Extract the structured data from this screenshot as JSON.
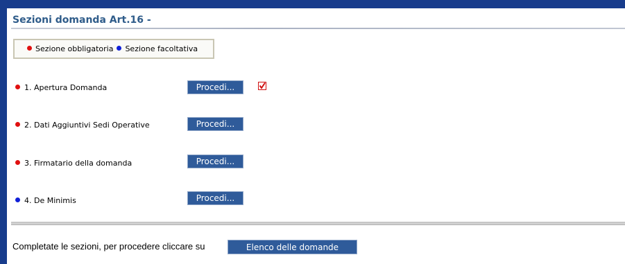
{
  "header": {
    "title": "Sezioni domanda Art.16 -"
  },
  "legend": {
    "mandatory_label": "Sezione obbligatoria",
    "optional_label": "Sezione facoltativa"
  },
  "sections": [
    {
      "label": "1. Apertura Domanda",
      "type": "obbligatoria",
      "button_label": "Procedi...",
      "completed": true
    },
    {
      "label": "2. Dati Aggiuntivi Sedi Operative",
      "type": "obbligatoria",
      "button_label": "Procedi...",
      "completed": false
    },
    {
      "label": "3. Firmatario della domanda",
      "type": "obbligatoria",
      "button_label": "Procedi...",
      "completed": false
    },
    {
      "label": "4. De Minimis",
      "type": "facoltativa",
      "button_label": "Procedi...",
      "completed": false
    }
  ],
  "footer": {
    "text": "Completate le sezioni, per procedere cliccare su",
    "button_label": "Elenco delle domande"
  },
  "colors": {
    "frame_blue": "#183c8c",
    "button_blue": "#2f5b9a",
    "title_blue": "#2f5c8a",
    "mandatory_dot": "#e01010",
    "optional_dot": "#1020d8",
    "check_red": "#e01010"
  },
  "icons": {
    "completed": "checkbox-checked-icon"
  }
}
